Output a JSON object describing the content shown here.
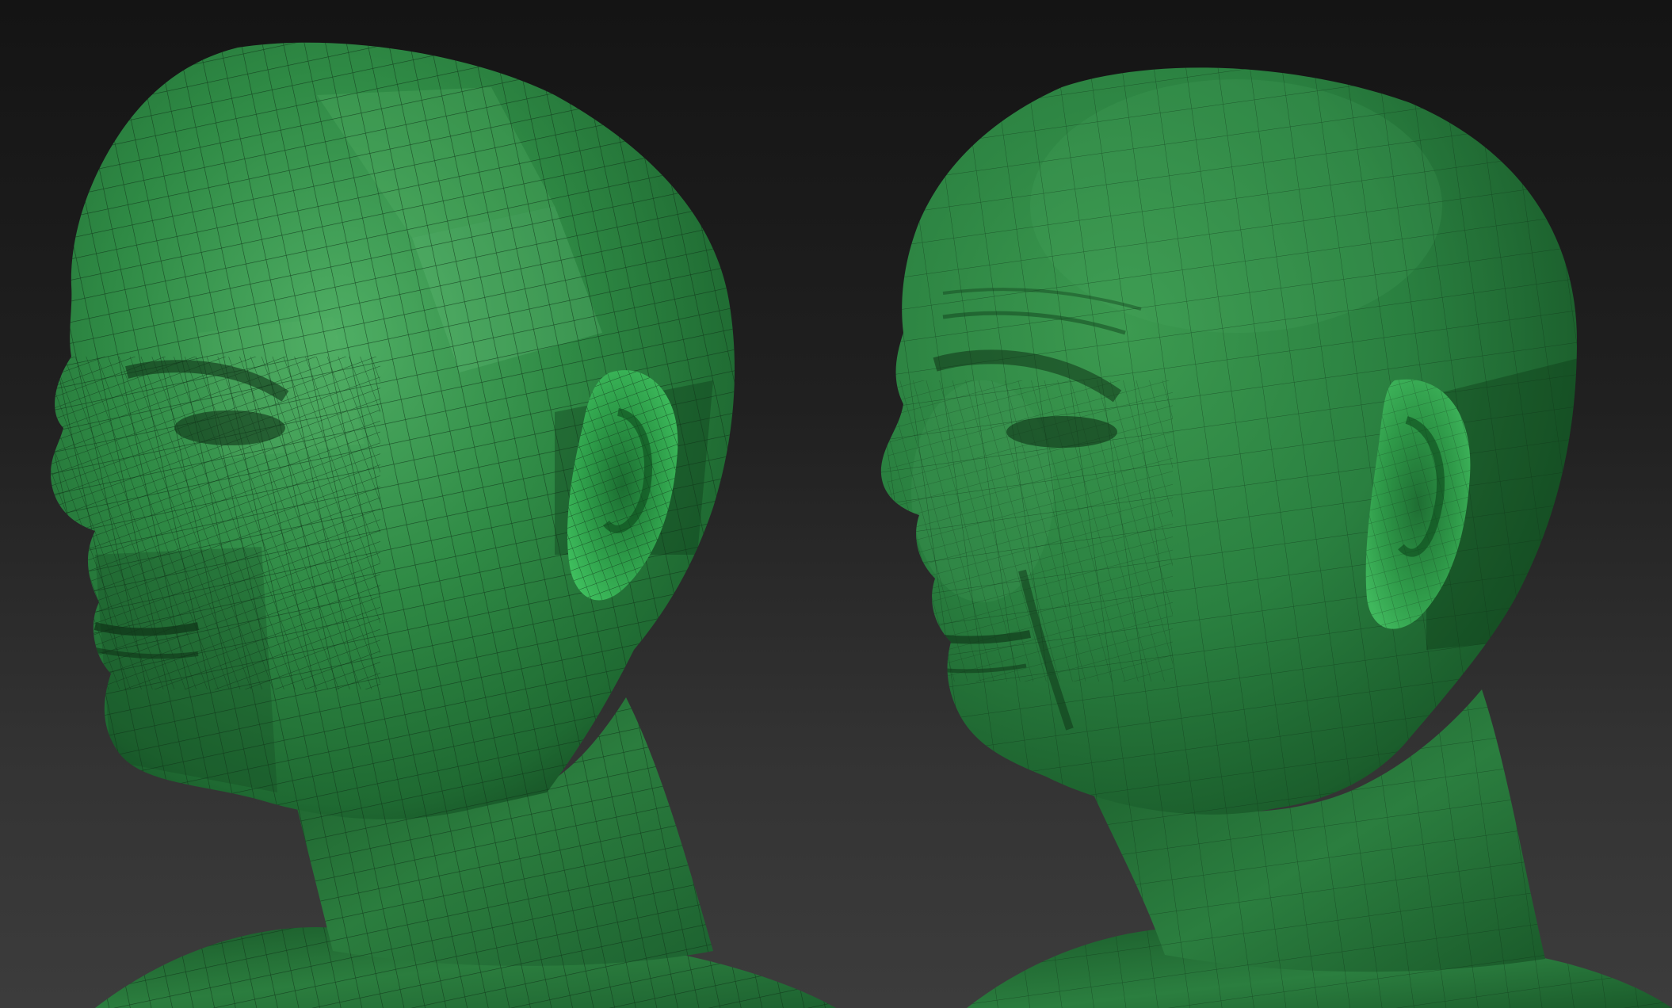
{
  "scene": {
    "background_color": "#242424",
    "model_color": "#2f8a45",
    "wire_color": "#123a1c"
  },
  "renders": [
    {
      "view": "base-mesh-wireframe",
      "shading": "faceted"
    },
    {
      "view": "sculpted-detail-wireframe",
      "shading": "smooth"
    }
  ]
}
